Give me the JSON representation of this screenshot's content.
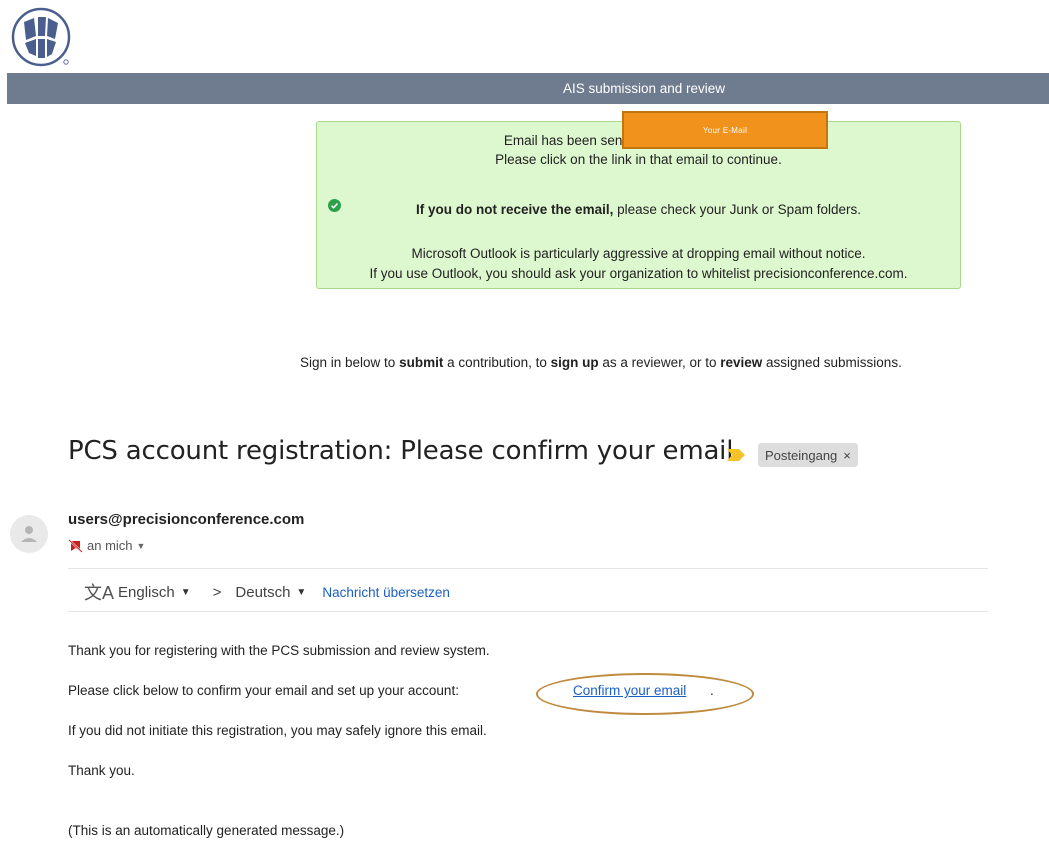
{
  "header": {
    "banner_title": "AIS submission and review"
  },
  "notice": {
    "line1_prefix": "Email has been sent to",
    "redacted_email": "Your E-Mail",
    "line2": "Please click on the link in that email to continue.",
    "warning_bold": "If you do not receive the email,",
    "warning_rest": " please check your Junk or Spam folders.",
    "outlook_line1": "Microsoft Outlook is particularly aggressive at dropping email without notice.",
    "outlook_line2": "If you use Outlook, you should ask your organization to whitelist precisionconference.com.",
    "status_color": "#2ea04a"
  },
  "signin": {
    "part1": "Sign in below to ",
    "submit": "submit",
    "part2": " a contribution, to ",
    "sign_up": "sign up",
    "part3": " as a reviewer, or to ",
    "review": "review",
    "part4": " assigned submissions."
  },
  "email": {
    "subject": "PCS account registration: Please confirm your email",
    "label": "Posteingang",
    "label_close": "×",
    "sender": "users@precisionconference.com",
    "recipient": "an mich",
    "translate": {
      "from_lang": "Englisch",
      "to_lang": "Deutsch",
      "action": "Nachricht übersetzen"
    },
    "body": {
      "line1": "Thank you for registering with the PCS submission and review system.",
      "line2": "Please click below to confirm your email and set up your account:",
      "confirm_link": "Confirm your email",
      "confirm_suffix": ".",
      "line3": "If you did not initiate this registration, you may safely ignore this email.",
      "line4": "Thank you.",
      "line5": "(This is an automatically generated message.)"
    }
  },
  "colors": {
    "banner": "#6f7b8e",
    "notice_bg": "#ddf7cf",
    "redaction": "#f0921c",
    "link": "#1a5fc4",
    "highlight": "#c08a3e"
  }
}
